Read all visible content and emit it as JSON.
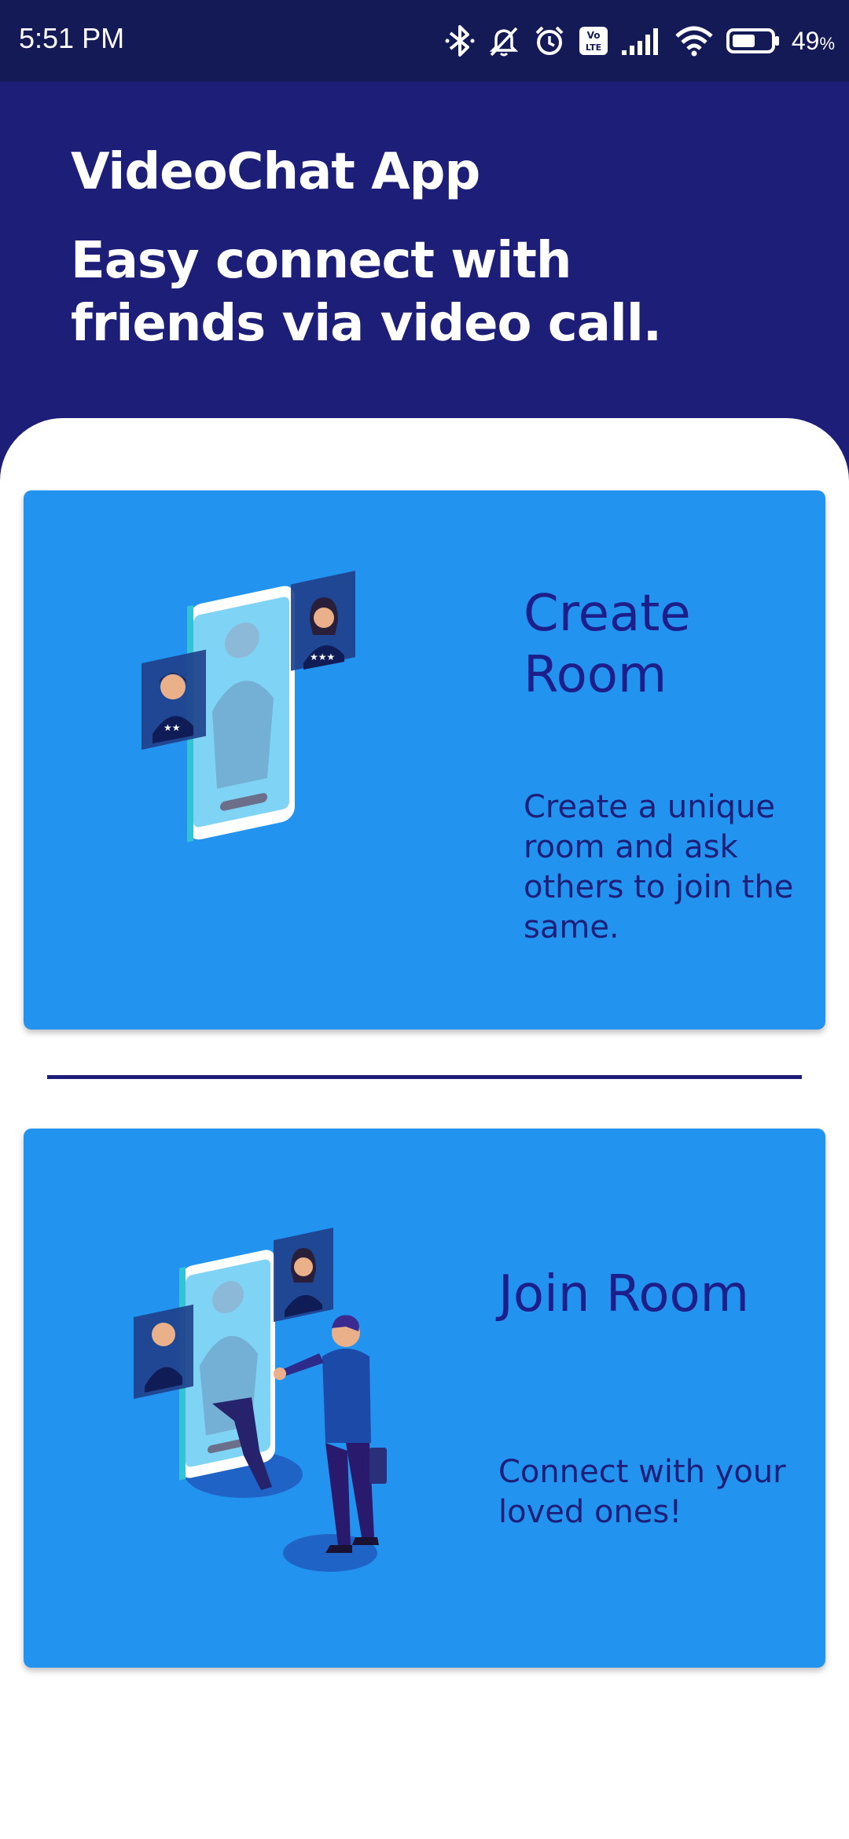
{
  "status_bar": {
    "time": "5:51 PM",
    "battery_percent": "49",
    "battery_suffix": "%",
    "icons": [
      "bluetooth-icon",
      "mute-icon",
      "alarm-icon",
      "volte-icon",
      "signal-icon",
      "wifi-icon",
      "battery-icon"
    ]
  },
  "header": {
    "title": "VideoChat App",
    "subtitle": "Easy connect with friends via video call."
  },
  "cards": {
    "create": {
      "title": "Create Room",
      "description": "Create a unique room and ask others to join the same."
    },
    "join": {
      "title": "Join Room",
      "description": "Connect with your loved ones!"
    }
  },
  "colors": {
    "header_bg": "#1c1e78",
    "status_bar_bg": "#141a56",
    "card_bg": "#2393f0",
    "card_text": "#1c1e8a",
    "divider": "#1c1e78"
  }
}
